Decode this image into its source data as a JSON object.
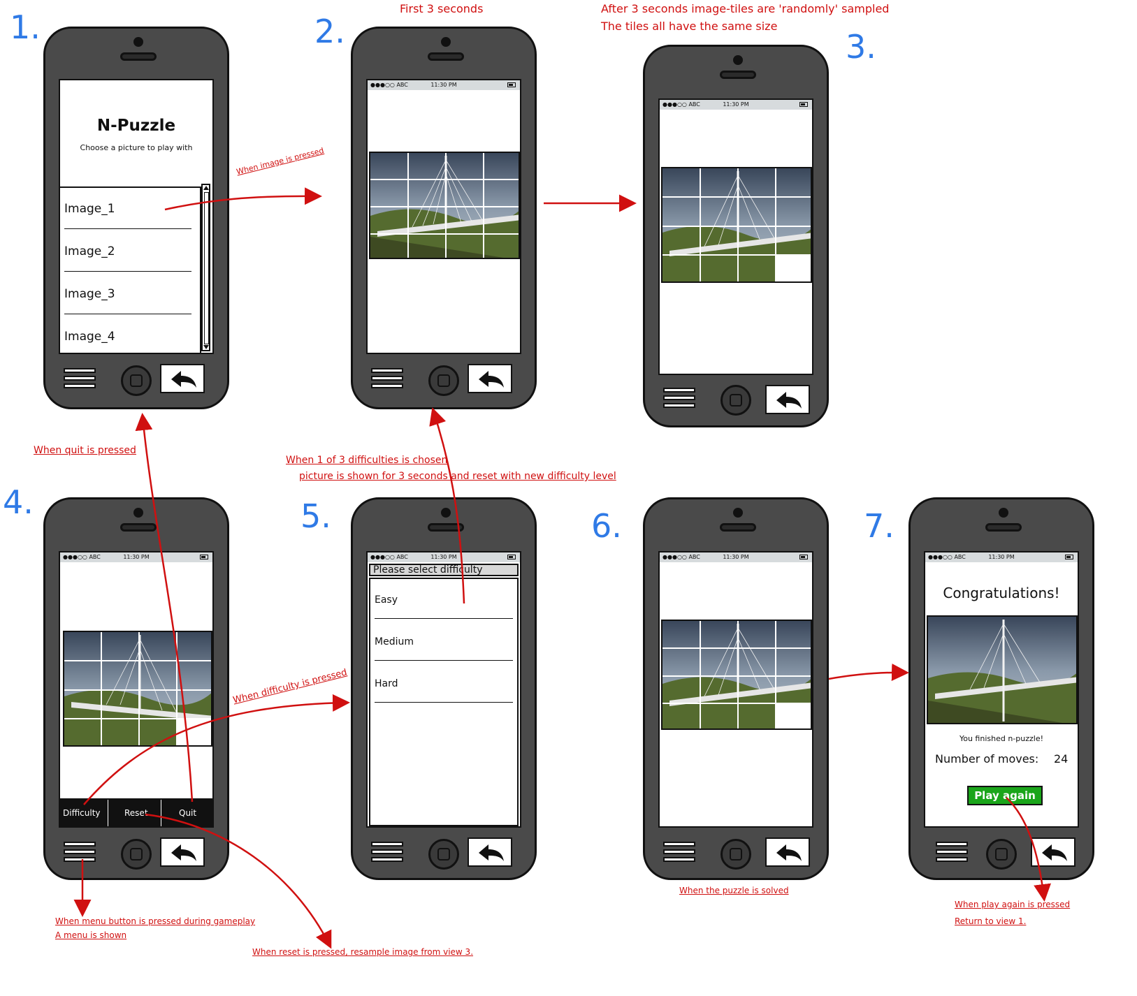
{
  "annotations": {
    "first_3_seconds": "First 3 seconds",
    "after_3_seconds": "After 3 seconds image-tiles are 'randomly' sampled",
    "same_size": "The tiles all have the same size",
    "when_image_pressed": "When image is pressed",
    "when_quit_pressed": "When quit is pressed",
    "when_difficulty_chosen": "When 1 of 3 difficulties is chosen",
    "picture_shown": "picture is shown for 3 seconds and reset with new difficulty level",
    "when_difficulty_pressed": "When difficulty is pressed",
    "when_menu_pressed": "When menu button is pressed during gameplay",
    "menu_shown": "A menu is shown",
    "when_reset_pressed": "When reset is pressed, resample image from view 3.",
    "when_solved": "When the puzzle is solved",
    "when_play_again": "When play again is pressed",
    "return_view1": "Return to view 1."
  },
  "step_numbers": [
    "1.",
    "2.",
    "3.",
    "4.",
    "5.",
    "6.",
    "7."
  ],
  "status_bar": {
    "carrier": "●●●○○ ABC",
    "time": "11:30 PM"
  },
  "view1": {
    "title": "N-Puzzle",
    "subtitle": "Choose a picture to play with",
    "images": [
      "Image_1",
      "Image_2",
      "Image_3",
      "Image_4"
    ]
  },
  "view4": {
    "menu": [
      "Difficulty",
      "Reset",
      "Quit"
    ]
  },
  "view5": {
    "header": "Please select difficulty",
    "options": [
      "Easy",
      "Medium",
      "Hard"
    ]
  },
  "view7": {
    "title": "Congratulations!",
    "message": "You finished n-puzzle!",
    "moves_label": "Number of moves:",
    "moves_value": "24",
    "play_again": "Play again"
  },
  "colors": {
    "annotation": "#d01010",
    "step_number": "#2f7ae6",
    "phone_body": "#4a4a4a",
    "play_again": "#1aa51a"
  }
}
